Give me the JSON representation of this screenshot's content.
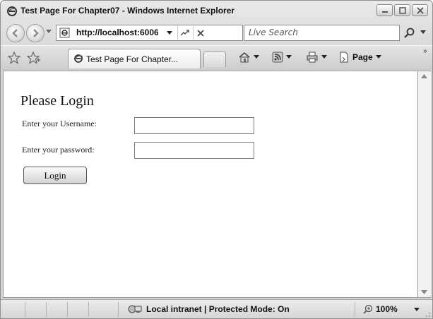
{
  "window": {
    "title": "Test Page For Chapter07 - Windows Internet Explorer",
    "icon": "ie-icon",
    "controls": [
      "minimize-icon",
      "maximize-icon",
      "close-icon"
    ]
  },
  "navigation": {
    "back_icon": "back-arrow-icon",
    "forward_icon": "forward-arrow-icon",
    "address_value": "http://localhost:6006",
    "refresh_icon": "refresh-icon",
    "stop_icon": "stop-icon",
    "search_placeholder": "Live Search",
    "search_icon": "search-icon"
  },
  "tabs": {
    "favorites_icon": "favorites-star-icon",
    "add_favorite_icon": "add-favorites-icon",
    "items": [
      {
        "label": "Test Page For Chapter...",
        "icon": "ie-icon"
      }
    ],
    "commands": {
      "home_icon": "home-icon",
      "feeds_icon": "feeds-icon",
      "print_icon": "print-icon",
      "page_label": "Page"
    }
  },
  "content": {
    "heading": "Please Login",
    "username_label": "Enter your Username:",
    "username_value": "",
    "password_label": "Enter your password:",
    "password_value": "",
    "login_button": "Login"
  },
  "status": {
    "zone_text": "Local intranet | Protected Mode: On",
    "zoom": "100%"
  }
}
